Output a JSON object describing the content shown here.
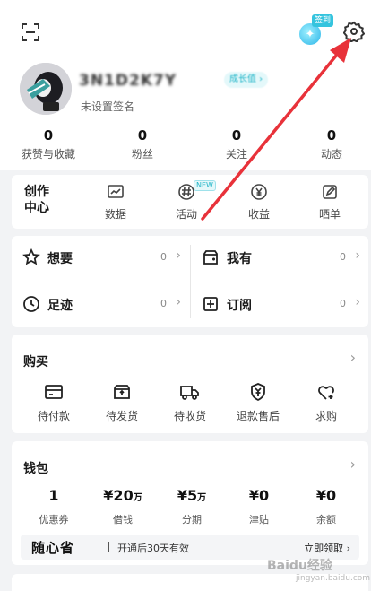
{
  "header": {
    "username": "3N1D2K7Y",
    "growth_badge": "成长值 ›",
    "signature": "未设置签名",
    "signin_tag": "签到"
  },
  "stats": [
    {
      "num": "0",
      "label": "获赞与收藏"
    },
    {
      "num": "0",
      "label": "粉丝"
    },
    {
      "num": "0",
      "label": "关注"
    },
    {
      "num": "0",
      "label": "动态"
    }
  ],
  "creator": {
    "title": "创作中心",
    "new_tag": "NEW",
    "items": [
      {
        "label": "数据",
        "icon": "chart-icon"
      },
      {
        "label": "活动",
        "icon": "hashtag-icon"
      },
      {
        "label": "收益",
        "icon": "yen-coin-icon"
      },
      {
        "label": "晒单",
        "icon": "edit-note-icon"
      }
    ]
  },
  "wants": [
    {
      "label": "想要",
      "count": "0",
      "icon": "star-icon"
    },
    {
      "label": "我有",
      "count": "0",
      "icon": "box-icon"
    },
    {
      "label": "足迹",
      "count": "0",
      "icon": "clock-icon"
    },
    {
      "label": "订阅",
      "count": "0",
      "icon": "plus-square-icon"
    }
  ],
  "buy": {
    "title": "购买",
    "items": [
      {
        "label": "待付款",
        "icon": "wallet-icon"
      },
      {
        "label": "待发货",
        "icon": "package-icon"
      },
      {
        "label": "待收货",
        "icon": "truck-icon"
      },
      {
        "label": "退款售后",
        "icon": "shield-yen-icon"
      },
      {
        "label": "求购",
        "icon": "heart-plus-icon"
      }
    ]
  },
  "wallet": {
    "title": "钱包",
    "items": [
      {
        "value": "1",
        "unit": "",
        "label": "优惠券"
      },
      {
        "value": "¥20",
        "unit": "万",
        "label": "借钱"
      },
      {
        "value": "¥5",
        "unit": "万",
        "label": "分期"
      },
      {
        "value": "¥0",
        "unit": "",
        "label": "津贴"
      },
      {
        "value": "¥0",
        "unit": "",
        "label": "余额"
      }
    ],
    "promo_brand": "随心省",
    "promo_text": "开通后30天有效",
    "promo_action": "立即领取 ›"
  },
  "watermark": {
    "main": "Baidu经验",
    "sub": "jingyan.baidu.com"
  },
  "colors": {
    "accent": "#22b5c8",
    "arrow": "#e8323a",
    "background": "#f2f3f5"
  }
}
